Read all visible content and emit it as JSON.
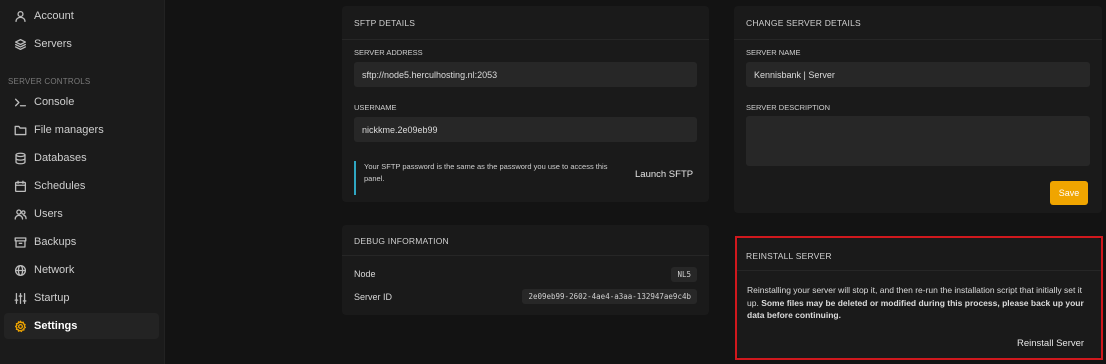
{
  "sidebar": {
    "items_top": [
      {
        "label": "Account",
        "icon": "user-icon"
      },
      {
        "label": "Servers",
        "icon": "layers-icon"
      }
    ],
    "section_heading": "SERVER CONTROLS",
    "items": [
      {
        "label": "Console",
        "icon": "terminal-icon"
      },
      {
        "label": "File managers",
        "icon": "folder-icon"
      },
      {
        "label": "Databases",
        "icon": "database-icon"
      },
      {
        "label": "Schedules",
        "icon": "calendar-icon"
      },
      {
        "label": "Users",
        "icon": "users-icon"
      },
      {
        "label": "Backups",
        "icon": "archive-icon"
      },
      {
        "label": "Network",
        "icon": "globe-icon"
      },
      {
        "label": "Startup",
        "icon": "sliders-icon"
      },
      {
        "label": "Settings",
        "icon": "gear-icon",
        "active": true
      }
    ]
  },
  "sftp": {
    "title": "SFTP DETAILS",
    "server_address_label": "SERVER ADDRESS",
    "server_address_value": "sftp://node5.herculhosting.nl:2053",
    "username_label": "USERNAME",
    "username_value": "nickkme.2e09eb99",
    "note": "Your SFTP password is the same as the password you use to access this panel.",
    "launch_label": "Launch SFTP"
  },
  "debug": {
    "title": "DEBUG INFORMATION",
    "node_label": "Node",
    "node_value": "NL5",
    "server_id_label": "Server ID",
    "server_id_value": "2e09eb99-2602-4ae4-a3aa-132947ae9c4b"
  },
  "change_server": {
    "title": "CHANGE SERVER DETAILS",
    "name_label": "SERVER NAME",
    "name_value": "Kennisbank | Server",
    "description_label": "SERVER DESCRIPTION",
    "description_value": "",
    "save_label": "Save"
  },
  "reinstall": {
    "title": "REINSTALL SERVER",
    "text_plain": "Reinstalling your server will stop it, and then re-run the installation script that initially set it up. ",
    "text_bold": "Some files may be deleted or modified during this process, please back up your data before continuing.",
    "button_label": "Reinstall Server"
  },
  "colors": {
    "accent": "#f0a500",
    "highlight_border": "#d0181d",
    "note_border": "#2fa6c2"
  }
}
